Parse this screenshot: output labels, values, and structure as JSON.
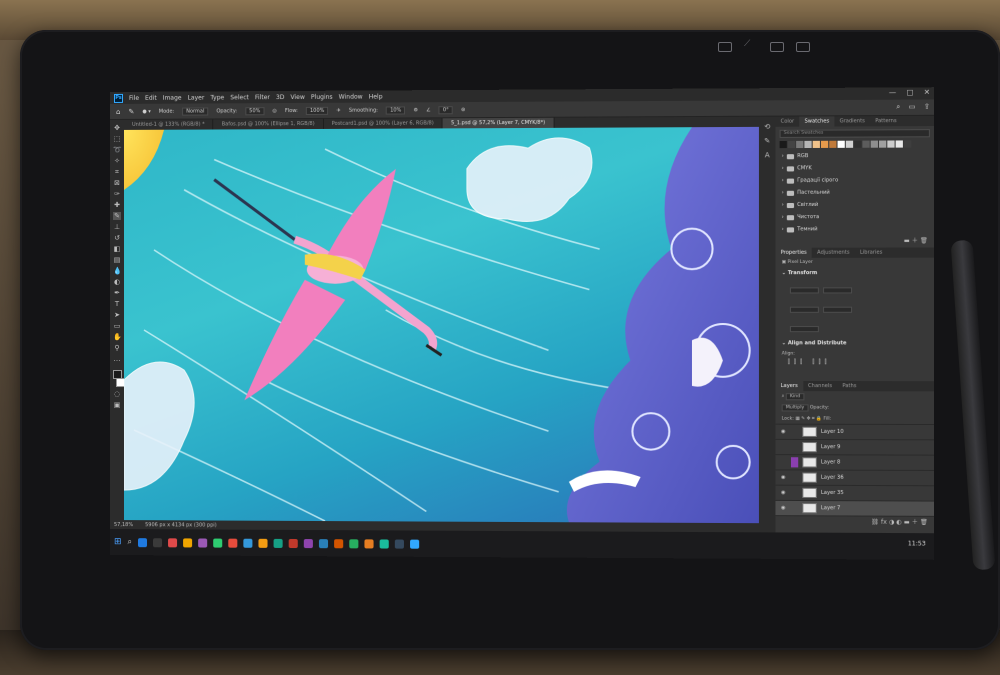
{
  "menubar": {
    "items": [
      "File",
      "Edit",
      "Image",
      "Layer",
      "Type",
      "Select",
      "Filter",
      "3D",
      "View",
      "Plugins",
      "Window",
      "Help"
    ]
  },
  "options": {
    "mode_label": "Mode:",
    "mode_value": "Normal",
    "opacity_label": "Opacity:",
    "opacity_value": "50%",
    "flow_label": "Flow:",
    "flow_value": "100%",
    "smoothing_label": "Smoothing:",
    "smoothing_value": "10%",
    "angle_value": "0°"
  },
  "tabs": [
    {
      "label": "Untitled-1 @ 133% (RGB/8) *",
      "active": false
    },
    {
      "label": "Bafos.psd @ 100% (Ellipse 1, RGB/8)",
      "active": false
    },
    {
      "label": "Postcard1.psd @ 100% (Layer 6, RGB/8)",
      "active": false
    },
    {
      "label": "5_1.psd @ 57,2% (Layer 7, CMYK/8*)",
      "active": true
    }
  ],
  "status": {
    "zoom": "57,18%",
    "doc": "5906 px x 4134 px (300 ppi)"
  },
  "clock": "11:53",
  "panel_top": {
    "tabs": [
      "Color",
      "Swatches",
      "Gradients",
      "Patterns"
    ],
    "active_tab": "Swatches",
    "search_placeholder": "Search Swatches",
    "swatch_colors": [
      "#1a1a1a",
      "#444444",
      "#7a7a7a",
      "#b5b5b5",
      "#f0c28a",
      "#e59a4c",
      "#c07a3a",
      "#ffffff",
      "#d0d0d0",
      "#2f2f2f",
      "#5c5c5c",
      "#8e8e8e",
      "#a0a0a0",
      "#cccccc",
      "#e8e8e8",
      "#3e3e3e"
    ],
    "folders": [
      "RGB",
      "CMYK",
      "Градації сірого",
      "Пастельний",
      "Світлий",
      "Чистота",
      "Темний"
    ]
  },
  "properties": {
    "tabs": [
      "Properties",
      "Adjustments",
      "Libraries"
    ],
    "active_tab": "Properties",
    "pixel_layer": "Pixel Layer",
    "transform": "Transform",
    "align": "Align and Distribute",
    "align_label": "Align:"
  },
  "layers": {
    "tabs": [
      "Layers",
      "Channels",
      "Paths"
    ],
    "active_tab": "Layers",
    "kind": "Kind",
    "blend": "Multiply",
    "opacity_label": "Opacity:",
    "lock_label": "Lock:",
    "fill_label": "Fill:",
    "items": [
      {
        "name": "Layer 10",
        "visible": true,
        "selected": false,
        "tag": false
      },
      {
        "name": "Layer 9",
        "visible": false,
        "selected": false,
        "tag": false
      },
      {
        "name": "Layer 8",
        "visible": false,
        "selected": false,
        "tag": true
      },
      {
        "name": "Layer 36",
        "visible": true,
        "selected": false,
        "tag": false
      },
      {
        "name": "Layer 35",
        "visible": true,
        "selected": false,
        "tag": false
      },
      {
        "name": "Layer 7",
        "visible": true,
        "selected": true,
        "tag": false
      }
    ]
  },
  "taskbar_colors": [
    "#1f7ae0",
    "#3a3a3a",
    "#e04a4a",
    "#f0a500",
    "#9b59b6",
    "#2ecc71",
    "#e74c3c",
    "#3498db",
    "#f39c12",
    "#16a085",
    "#c0392b",
    "#8e44ad",
    "#2980b9",
    "#d35400",
    "#27ae60",
    "#e67e22",
    "#1abc9c",
    "#34495e",
    "#31a8ff"
  ]
}
